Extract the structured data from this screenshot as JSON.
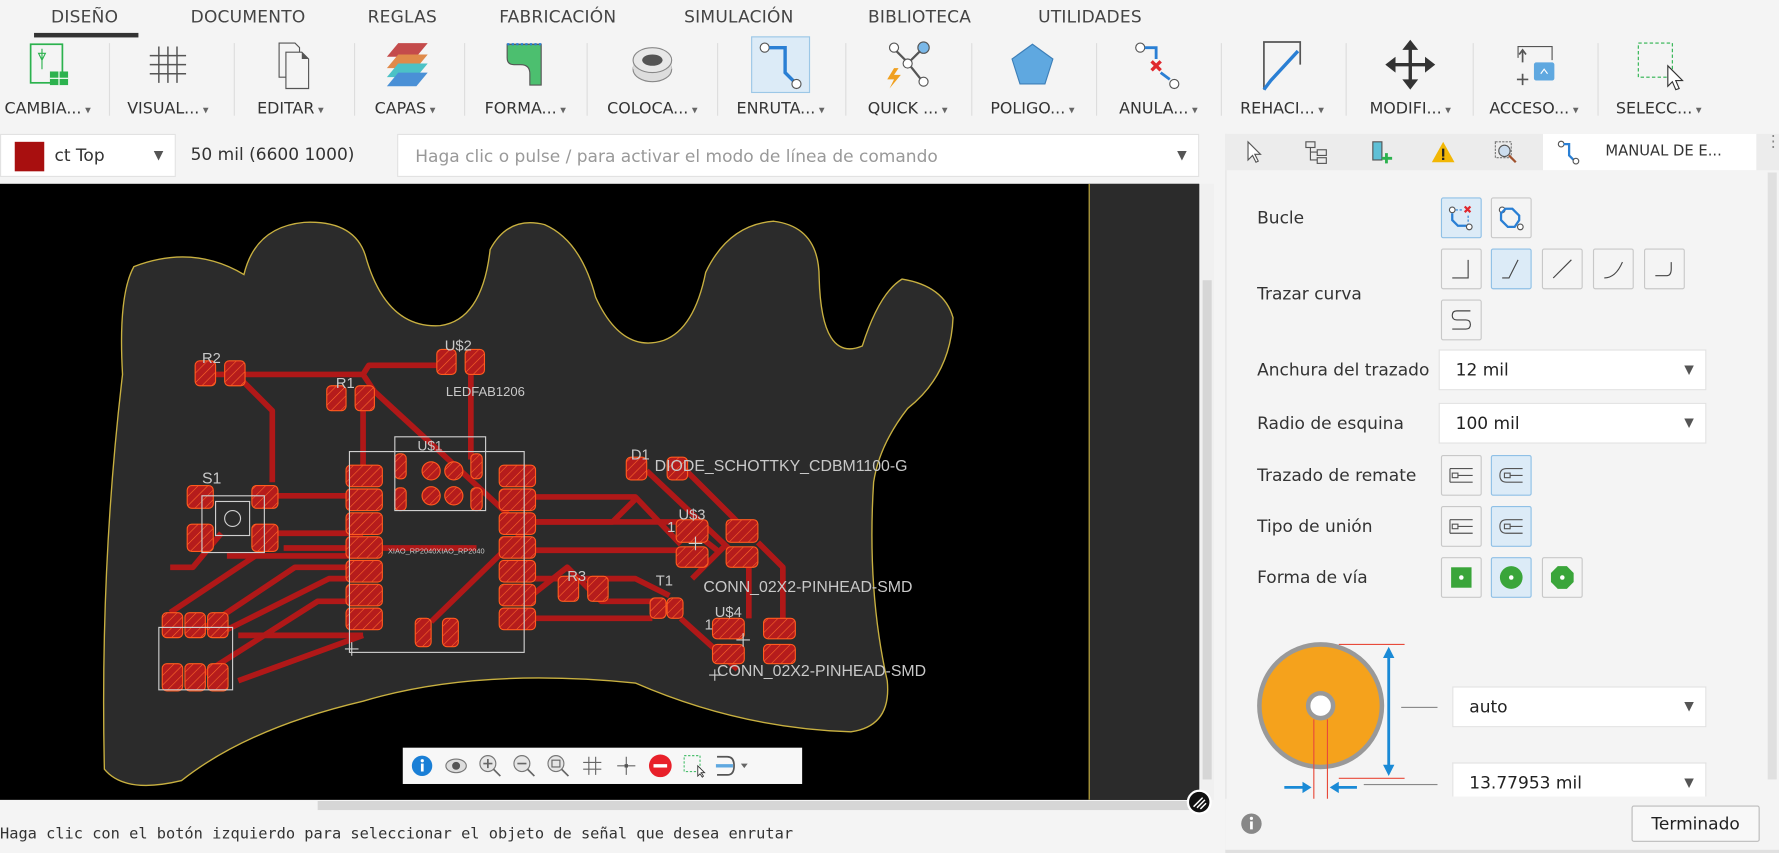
{
  "ribbon_tabs": [
    "DISEÑO",
    "DOCUMENTO",
    "REGLAS",
    "FABRICACIÓN",
    "SIMULACIÓN",
    "BIBLIOTECA",
    "UTILIDADES"
  ],
  "active_tab": "DISEÑO",
  "toolbar": [
    {
      "label": "CAMBIA...",
      "icon": "switch-schematic-icon"
    },
    {
      "label": "VISUAL...",
      "icon": "grid-icon"
    },
    {
      "label": "EDITAR",
      "icon": "copy-icon"
    },
    {
      "label": "CAPAS",
      "icon": "layers-icon"
    },
    {
      "label": "FORMA...",
      "icon": "board-shape-icon"
    },
    {
      "label": "COLOCA...",
      "icon": "via-icon"
    },
    {
      "label": "ENRUTA...",
      "icon": "route-icon",
      "active": true
    },
    {
      "label": "QUICK ...",
      "icon": "quick-route-icon"
    },
    {
      "label": "POLIGO...",
      "icon": "polygon-icon"
    },
    {
      "label": "ANULA...",
      "icon": "unroute-icon"
    },
    {
      "label": "REHACI...",
      "icon": "redo-route-icon"
    },
    {
      "label": "MODIFI...",
      "icon": "move-icon"
    },
    {
      "label": "ACCESO...",
      "icon": "access-icon"
    },
    {
      "label": "SELECC...",
      "icon": "select-icon"
    }
  ],
  "layer_select": {
    "value": "ct Top",
    "color": "#a80f0f"
  },
  "coordinates": "50 mil (6600 1000)",
  "command_input": {
    "placeholder": "Haga clic o pulse / para activar el modo de línea de comando"
  },
  "board": {
    "labels": {
      "r2": "R2",
      "r1": "R1",
      "us2": "U$2",
      "ledfab": "LEDFAB1206",
      "u1": "U$1",
      "s1": "S1",
      "xiao": "XIAO_RP2040XIAO_RP2040",
      "d1": "D1",
      "diode": "DIODE_SCHOTTKY_CDBM1100-G",
      "us3": "U$3",
      "one3": "1",
      "r3": "R3",
      "t1": "T1",
      "conn1": "CONN_02X2-PINHEAD-SMD",
      "us4": "U$4",
      "one4": "1",
      "conn2": "CONN_02X2-PINHEAD-SMD"
    },
    "colors": {
      "background": "#000000",
      "board": "#2b2b2b",
      "outline": "#c8b040",
      "trace": "#b01818",
      "pad": "#b51c1c",
      "pad_outline": "#ff5a1f"
    }
  },
  "view_toolbar": [
    "info-icon",
    "eye-icon",
    "zoom-in-icon",
    "zoom-out-icon",
    "zoom-fit-icon",
    "grid-icon",
    "crosshair-icon",
    "stop-icon",
    "select-area-icon",
    "route-mode-icon"
  ],
  "status_text": "Haga clic con el botón izquierdo para seleccionar el objeto de señal que desea enrutar",
  "panel": {
    "tab_active": "MANUAL DE E...",
    "rows": {
      "loop": "Bucle",
      "bend": "Trazar curva",
      "width": "Anchura del trazado",
      "radius": "Radio de esquina",
      "cap": "Trazado de remate",
      "join": "Tipo de unión",
      "via_shape": "Forma de vía"
    },
    "width_value": "12 mil",
    "radius_value": "100 mil",
    "via_diameter": "auto",
    "via_drill": "13.77953 mil",
    "done_button": "Terminado"
  }
}
